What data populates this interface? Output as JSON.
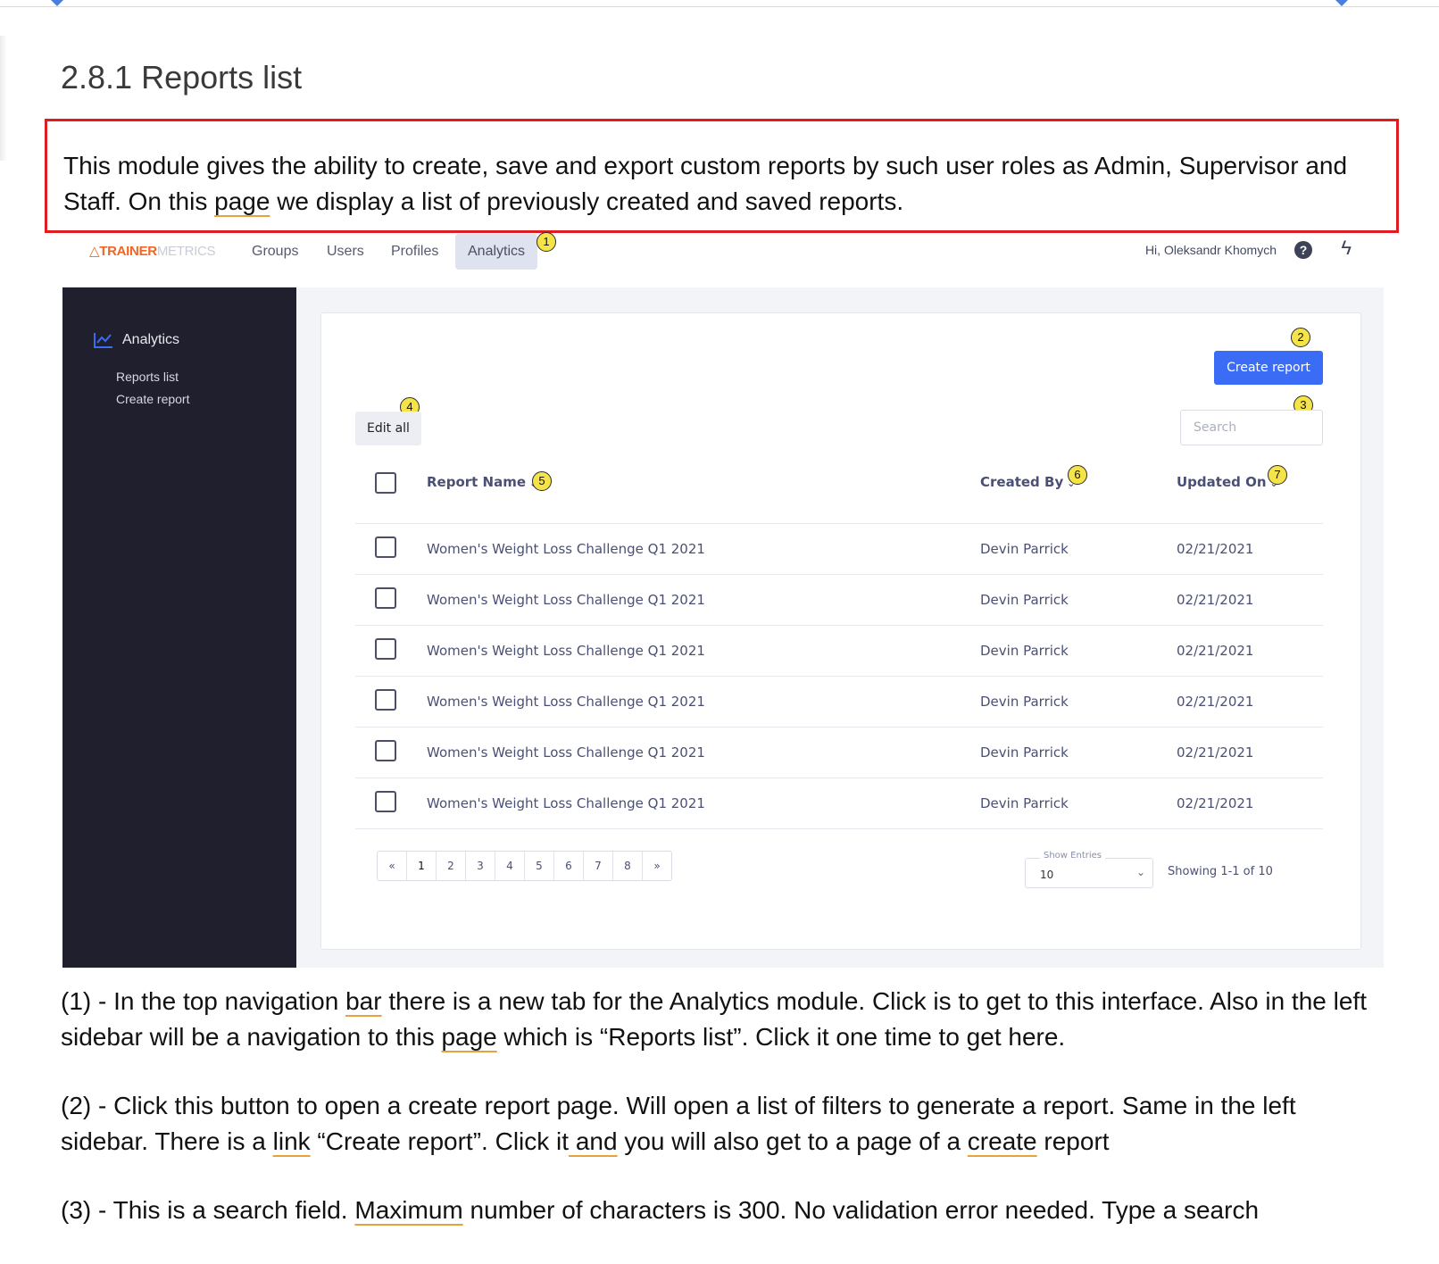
{
  "doc": {
    "title": "2.8.1 Reports list",
    "intro": {
      "before": "This module gives the ability to create, save and export custom reports by such user roles as Admin, Supervisor and Staff. On this ",
      "mark": "page",
      "after": " we display a list of previously created and saved reports."
    },
    "paragraphs": [
      {
        "segments": [
          {
            "text": "(1) - In the top navigation ",
            "mark": false
          },
          {
            "text": "bar",
            "mark": true
          },
          {
            "text": " there is a new tab for the Analytics module. Click is to get to this interface. Also in the left sidebar will be a navigation to this ",
            "mark": false
          },
          {
            "text": "page",
            "mark": true
          },
          {
            "text": " which is “Reports list”. Click it one time to get here.",
            "mark": false
          }
        ]
      },
      {
        "segments": [
          {
            "text": "(2) - Click this button to open a create report page. Will open a list of filters to generate a report. Same in the left sidebar. There is a ",
            "mark": false
          },
          {
            "text": "link",
            "mark": true
          },
          {
            "text": " “Create report”. Click it",
            "mark": false
          },
          {
            "text": " and",
            "mark": true
          },
          {
            "text": " you will also get to a page of a ",
            "mark": false
          },
          {
            "text": "create",
            "mark": true
          },
          {
            "text": " report",
            "mark": false
          }
        ]
      },
      {
        "segments": [
          {
            "text": "(3) - This is a search field. ",
            "mark": false
          },
          {
            "text": "Maximum",
            "mark": true
          },
          {
            "text": " number of characters is 300. No validation error needed. Type a search",
            "mark": false
          }
        ]
      }
    ]
  },
  "app": {
    "logo": {
      "icon": "triangle-logo-icon",
      "strong": "TRAINER",
      "light": "METRICS"
    },
    "nav_tabs": [
      "Groups",
      "Users",
      "Profiles",
      "Analytics"
    ],
    "active_tab": "Analytics",
    "greeting": "Hi, Oleksandr Khomych",
    "icons": {
      "help": "help-circle-icon",
      "bolt": "lightning-icon"
    },
    "sidebar": {
      "heading": "Analytics",
      "heading_icon": "line-chart-icon",
      "links": [
        "Reports list",
        "Create report"
      ]
    },
    "create_button": "Create report",
    "edit_all_button": "Edit all",
    "search_placeholder": "Search",
    "columns": {
      "name": "Report Name",
      "created_by": "Created By",
      "updated_on": "Updated On"
    },
    "rows": [
      {
        "name": "Women's Weight Loss Challenge Q1 2021",
        "created_by": "Devin Parrick",
        "updated_on": "02/21/2021"
      },
      {
        "name": "Women's Weight Loss Challenge Q1 2021",
        "created_by": "Devin Parrick",
        "updated_on": "02/21/2021"
      },
      {
        "name": "Women's Weight Loss Challenge Q1 2021",
        "created_by": "Devin Parrick",
        "updated_on": "02/21/2021"
      },
      {
        "name": "Women's Weight Loss Challenge Q1 2021",
        "created_by": "Devin Parrick",
        "updated_on": "02/21/2021"
      },
      {
        "name": "Women's Weight Loss Challenge Q1 2021",
        "created_by": "Devin Parrick",
        "updated_on": "02/21/2021"
      },
      {
        "name": "Women's Weight Loss Challenge Q1 2021",
        "created_by": "Devin Parrick",
        "updated_on": "02/21/2021"
      }
    ],
    "pagination": {
      "first": "«",
      "pages": [
        "1",
        "2",
        "3",
        "4",
        "5",
        "6",
        "7",
        "8"
      ],
      "last": "»",
      "current": "1"
    },
    "show_entries_label": "Show Entries",
    "show_entries_value": "10",
    "showing_text": "Showing 1-1 of 10",
    "badges": [
      "1",
      "2",
      "3",
      "4",
      "5",
      "6",
      "7"
    ],
    "colors": {
      "primary": "#3b6cf6",
      "sidebar": "#1f1f2e",
      "badge": "#f5e34a",
      "highlight_border": "#e11b22",
      "logo_accent": "#f26522"
    }
  }
}
